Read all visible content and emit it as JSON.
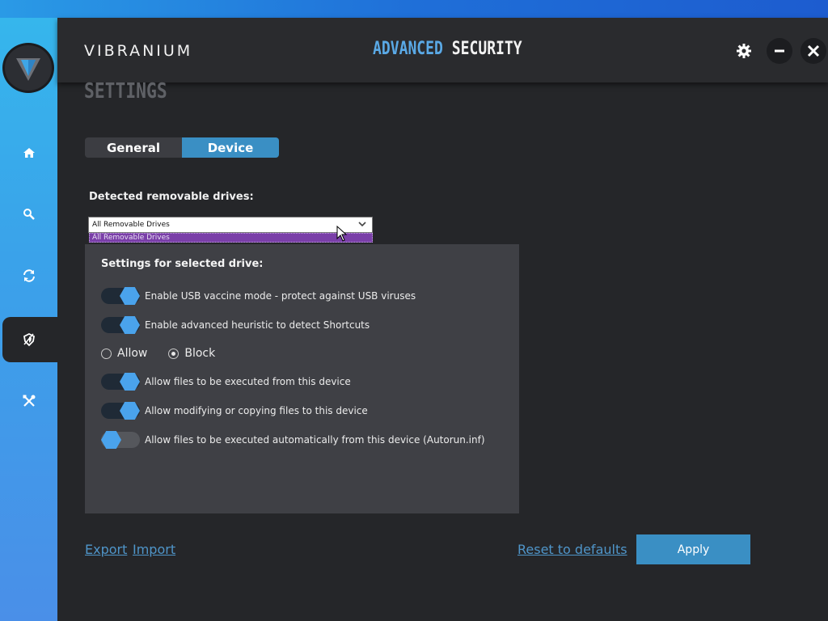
{
  "header": {
    "brand": "VIBRANIUM",
    "title_accent": "ADVANCED",
    "title_main": "SECURITY",
    "icons": [
      "gear-icon",
      "minimize-icon",
      "close-icon"
    ]
  },
  "sidebar": {
    "items": [
      {
        "icon": "home-icon"
      },
      {
        "icon": "search-icon"
      },
      {
        "icon": "refresh-icon"
      },
      {
        "icon": "shield-icon",
        "active": true
      },
      {
        "icon": "tools-icon"
      }
    ]
  },
  "page": {
    "title": "SETTINGS",
    "tabs": [
      {
        "label": "General",
        "active": false
      },
      {
        "label": "Device",
        "active": true
      }
    ]
  },
  "drives": {
    "label": "Detected removable drives:",
    "selected": "All Removable Drives",
    "options": [
      "All Removable Drives"
    ]
  },
  "panel": {
    "heading": "Settings for selected drive:",
    "toggles": [
      {
        "label": "Enable USB vaccine mode - protect against USB viruses",
        "on": true
      },
      {
        "label": "Enable advanced heuristic to detect Shortcuts",
        "on": true
      },
      {
        "label": "Allow files to be executed from this device",
        "on": true
      },
      {
        "label": "Allow modifying or copying files to this device",
        "on": true
      },
      {
        "label": "Allow files to be executed automatically from this device (Autorun.inf)",
        "on": false
      }
    ],
    "radio": {
      "options": [
        "Allow",
        "Block"
      ],
      "selected": "Block"
    }
  },
  "footer": {
    "export": "Export",
    "import": "Import",
    "reset": "Reset to defaults",
    "apply": "Apply"
  },
  "colors": {
    "accent": "#3a8fc4",
    "toggle_knob": "#4aa3ec",
    "sidebar": "#36b6ec",
    "background": "#252629",
    "panel": "#3f4045",
    "dropdown_highlight": "#7a3fa8"
  }
}
